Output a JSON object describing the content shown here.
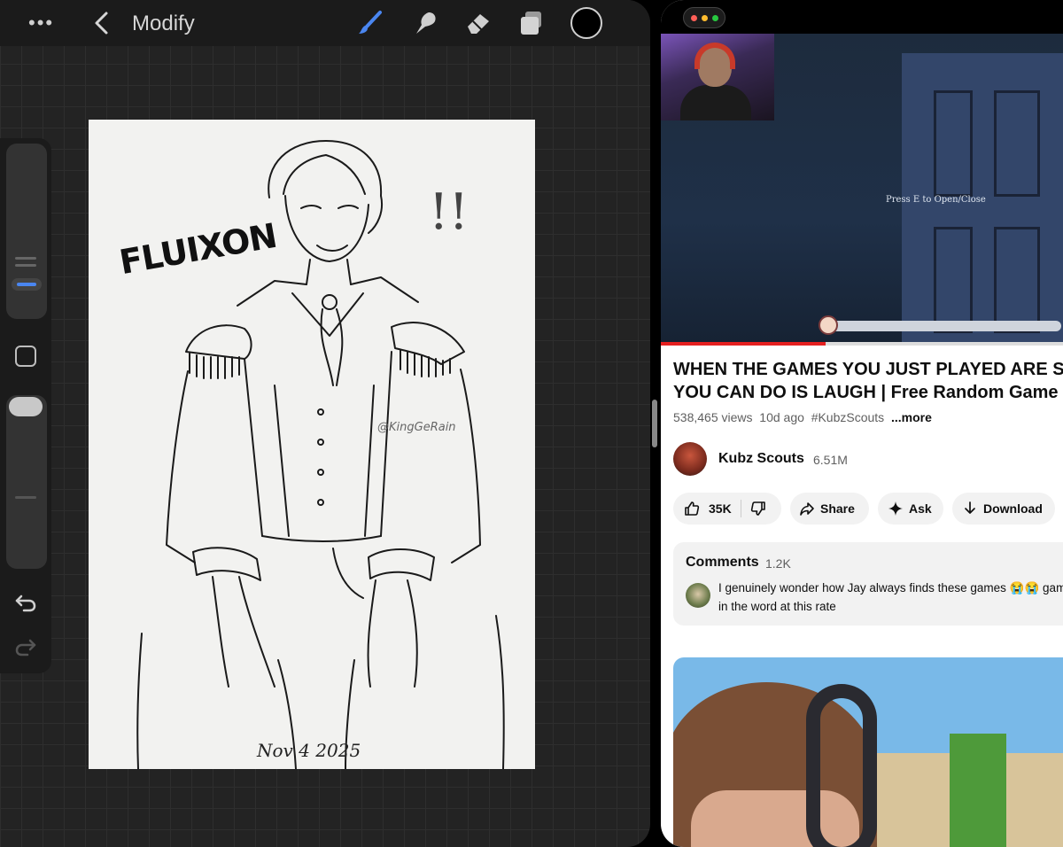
{
  "procreate": {
    "title": "Modify",
    "tools": [
      "brush-icon",
      "smudge-icon",
      "eraser-icon",
      "layers-icon"
    ],
    "current_color": "#000000",
    "accent_color": "#4a86f0",
    "canvas": {
      "lettering": "FLUIXON",
      "exclamation": "!!",
      "watermark": "@KingGeRain",
      "date": "Nov 4 2025"
    }
  },
  "youtube": {
    "video": {
      "game_prompt": "Press E to Open/Close",
      "progress_fraction": 0.41
    },
    "title": "WHEN THE GAMES YOU JUST PLAYED ARE S YOU CAN DO IS LAUGH | Free Random Game",
    "title_line1": "WHEN THE GAMES YOU JUST PLAYED ARE S",
    "title_line2": "YOU CAN DO IS LAUGH | Free Random Game",
    "views": "538,465 views",
    "age": "10d ago",
    "hashtag": "#KubzScouts",
    "more": "...more",
    "channel": {
      "name": "Kubz Scouts",
      "subscribers": "6.51M"
    },
    "actions": {
      "likes": "35K",
      "share": "Share",
      "ask": "Ask",
      "download": "Download"
    },
    "comments": {
      "label": "Comments",
      "count": "1.2K",
      "top_comment": "I genuinely wonder how Jay always finds these games 😭😭 game in the word at this rate"
    },
    "brand_color": "#e52020"
  }
}
